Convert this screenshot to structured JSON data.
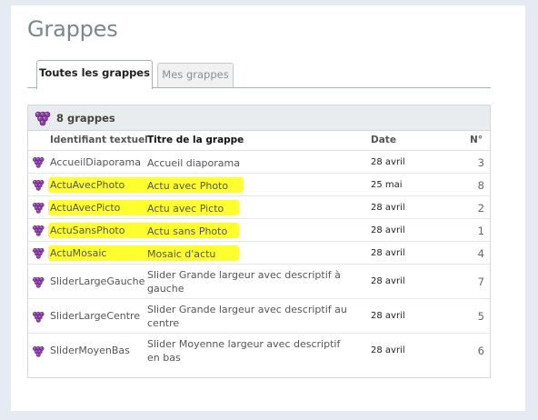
{
  "header": {
    "title": "Grappes"
  },
  "tabs": [
    {
      "label": "Toutes les grappes",
      "active": true
    },
    {
      "label": "Mes grappes",
      "active": false
    }
  ],
  "list": {
    "count_label": "8 grappes",
    "columns": [
      "Identifiant textuel",
      "Titre de la grappe",
      "Date",
      "N°"
    ],
    "rows": [
      {
        "id": "AccueilDiaporama",
        "title": "Accueil diaporama",
        "date": "28 avril",
        "num": "3",
        "highlighted": false
      },
      {
        "id": "ActuAvecPhoto",
        "title": "Actu avec Photo",
        "date": "25 mai",
        "num": "8",
        "highlighted": true
      },
      {
        "id": "ActuAvecPicto",
        "title": "Actu avec Picto",
        "date": "28 avril",
        "num": "2",
        "highlighted": true
      },
      {
        "id": "ActuSansPhoto",
        "title": "Actu sans Photo",
        "date": "28 avril",
        "num": "1",
        "highlighted": true
      },
      {
        "id": "ActuMosaic",
        "title": "Mosaic d'actu",
        "date": "28 avril",
        "num": "4",
        "highlighted": true
      },
      {
        "id": "SliderLargeGauche",
        "title": "Slider Grande largeur avec descriptif à gauche",
        "date": "28 avril",
        "num": "7",
        "highlighted": false
      },
      {
        "id": "SliderLargeCentre",
        "title": "Slider Grande largeur avec descriptif au centre",
        "date": "28 avril",
        "num": "5",
        "highlighted": false
      },
      {
        "id": "SliderMoyenBas",
        "title": "Slider Moyenne largeur avec descriptif en bas",
        "date": "28 avril",
        "num": "6",
        "highlighted": false
      }
    ]
  },
  "icons": {
    "grape": "grape-icon"
  },
  "colors": {
    "highlight": "#ffff33",
    "grape": "#8e3fa8"
  }
}
